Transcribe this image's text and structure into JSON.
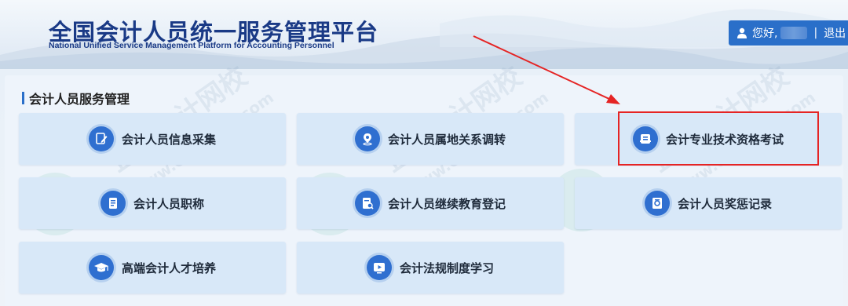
{
  "header": {
    "title": "全国会计人员统一服务管理平台",
    "subtitle": "National Unified Service Management Platform for Accounting Personnel",
    "greeting": "您好,",
    "separator": "|",
    "logout_label": "退出"
  },
  "section": {
    "title": "会计人员服务管理"
  },
  "tiles": [
    {
      "label": "会计人员信息采集",
      "icon": "edit-document-icon"
    },
    {
      "label": "会计人员属地关系调转",
      "icon": "location-pin-icon"
    },
    {
      "label": "会计专业技术资格考试",
      "icon": "exam-document-icon"
    },
    {
      "label": "会计人员职称",
      "icon": "certificate-icon"
    },
    {
      "label": "会计人员继续教育登记",
      "icon": "education-record-icon"
    },
    {
      "label": "会计人员奖惩记录",
      "icon": "reward-record-icon"
    },
    {
      "label": "高端会计人才培养",
      "icon": "graduation-cap-icon"
    },
    {
      "label": "会计法规制度学习",
      "icon": "video-play-icon"
    }
  ],
  "watermark": {
    "text_cn": "正保会计网校",
    "text_url": "www.chinaacc.com"
  },
  "colors": {
    "brand": "#1a3a86",
    "accent": "#2a6fc9",
    "highlight": "#e52424"
  }
}
